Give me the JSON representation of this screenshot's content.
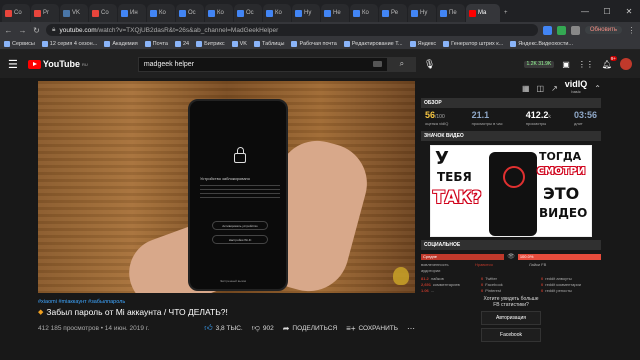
{
  "browser": {
    "tabs": [
      {
        "label": "Co",
        "color": "#e8453c"
      },
      {
        "label": "Pr",
        "color": "#e8453c"
      },
      {
        "label": "VK",
        "color": "#4a76a8"
      },
      {
        "label": "Co",
        "color": "#e8453c"
      },
      {
        "label": "Ин",
        "color": "#4285f4"
      },
      {
        "label": "Ко",
        "color": "#4285f4"
      },
      {
        "label": "Ос",
        "color": "#4285f4"
      },
      {
        "label": "Ко",
        "color": "#4285f4"
      },
      {
        "label": "Ос",
        "color": "#4285f4"
      },
      {
        "label": "Ко",
        "color": "#4285f4"
      },
      {
        "label": "Ну",
        "color": "#4285f4"
      },
      {
        "label": "Не",
        "color": "#4285f4"
      },
      {
        "label": "Ко",
        "color": "#4285f4"
      },
      {
        "label": "Ре",
        "color": "#4285f4"
      },
      {
        "label": "Ну",
        "color": "#4285f4"
      },
      {
        "label": "Пе",
        "color": "#4285f4"
      },
      {
        "label": "Ma",
        "color": "#ff0000"
      }
    ],
    "url_host": "youtube.com",
    "url_path": "/watch?v=TXQjUB2dasR&t=26s&ab_channel=MadGeekHelper",
    "update_label": "Обновить",
    "bookmarks": [
      "Сервисы",
      "12 серия 4 сезон...",
      "Академия",
      "Почта",
      "24",
      "Битрикс",
      "VK",
      "Таблицы",
      "Рабочая почта",
      "Редактирование Т...",
      "Яндекс",
      "Генератор штрих к...",
      "Яндекс.Видеохости..."
    ]
  },
  "youtube": {
    "logo": "YouTube",
    "logo_region": "RU",
    "search_value": "madgeek helper",
    "views_counter": "1.2K 31.9K",
    "notifications": "9+"
  },
  "video": {
    "phone_title": "Устройство заблокировано",
    "phone_btn1": "Активировать устройство",
    "phone_btn2": "Настройки Wi-Fi",
    "phone_footer": "Экстренный вызов",
    "tags": "#xiaomi #miаккаунт #забылпароль",
    "title": "Забыл пароль от Mi аккаунта / ЧТО ДЕЛАТЬ?!",
    "views": "412 185 просмотров • 14 июн. 2019 г.",
    "likes": "3,8 ТЫС.",
    "dislikes": "902",
    "share": "ПОДЕЛИТЬСЯ",
    "save": "СОХРАНИТЬ"
  },
  "vidiq": {
    "logo": "vidIQ",
    "logo_sub": "basic",
    "overview_header": "ОБЗОР",
    "stats": [
      {
        "value": "56",
        "suffix": "/100",
        "label": "оценка vidIQ",
        "color": "#f5c542"
      },
      {
        "value": "21.1",
        "suffix": "",
        "label": "просмотры в час",
        "color": "#8fa8c8"
      },
      {
        "value": "412.2",
        "suffix": "k",
        "label": "просмотры",
        "color": "#ffffff"
      },
      {
        "value": "03:56",
        "suffix": "",
        "label": "длит",
        "color": "#8fa8c8"
      }
    ],
    "thumb_header": "ЗНАЧОК ВИДЕО",
    "thumb_words": [
      "У",
      "ТЕБЯ",
      "ТАК?",
      "ТОГДА",
      "СМОТРИ",
      "ЭТО",
      "ВИДЕО"
    ],
    "social_header": "СОЦИАЛЬНОЕ",
    "engagement_bar": "Средне",
    "likes_bar": "100.0%",
    "engagement_label": "вовлеченность аудитории",
    "likes_label": "Нравится",
    "fb_label": "Лайки FB",
    "social_col1": [
      [
        "81.2",
        "лайков"
      ],
      [
        "2,691",
        "комментариев"
      ],
      [
        "1.06",
        "..."
      ]
    ],
    "social_col2": [
      [
        "0",
        "Twitter"
      ],
      [
        "0",
        "Facebook"
      ],
      [
        "0",
        "Pinterest"
      ]
    ],
    "social_col3": [
      [
        "0",
        "reddit апвоуты"
      ],
      [
        "0",
        "reddit комментарии"
      ],
      [
        "0",
        "reddit репосты"
      ]
    ],
    "fb_question": "Хотите увидеть больше FB статистики?",
    "auth_btn": "Авторизация",
    "fb_btn": "Facebook"
  }
}
